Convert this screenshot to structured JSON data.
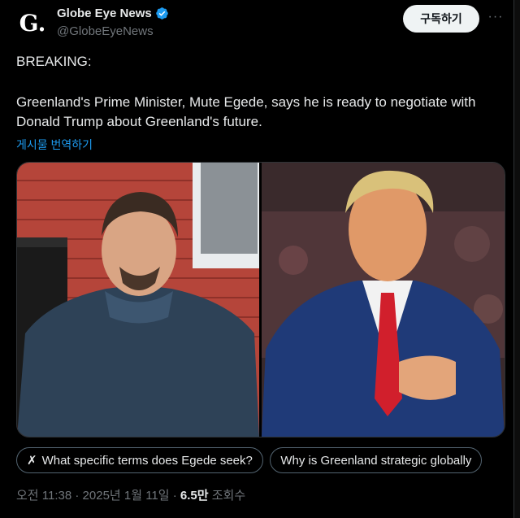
{
  "author": {
    "avatar_letter": "G.",
    "name": "Globe Eye News",
    "handle": "@GlobeEyeNews",
    "verified_color": "#1d9bf0"
  },
  "actions": {
    "subscribe_label": "구독하기",
    "more_label": "···"
  },
  "tweet": {
    "line1": "BREAKING:",
    "line2": "Greenland's Prime Minister, Mute Egede, says he is ready to negotiate with Donald Trump about Greenland's future.",
    "translate_label": "게시물 번역하기"
  },
  "suggestions": [
    {
      "icon": "grok-icon",
      "label": "What specific terms does Egede seek?"
    },
    {
      "label": "Why is Greenland strategic globally"
    }
  ],
  "meta": {
    "time": "오전 11:38",
    "sep1": "·",
    "date": "2025년 1월 11일",
    "sep2": "·",
    "views": "6.5만",
    "views_label": "조회수"
  },
  "colors": {
    "accent": "#1d9bf0",
    "background": "#000000",
    "muted": "#71767b"
  }
}
